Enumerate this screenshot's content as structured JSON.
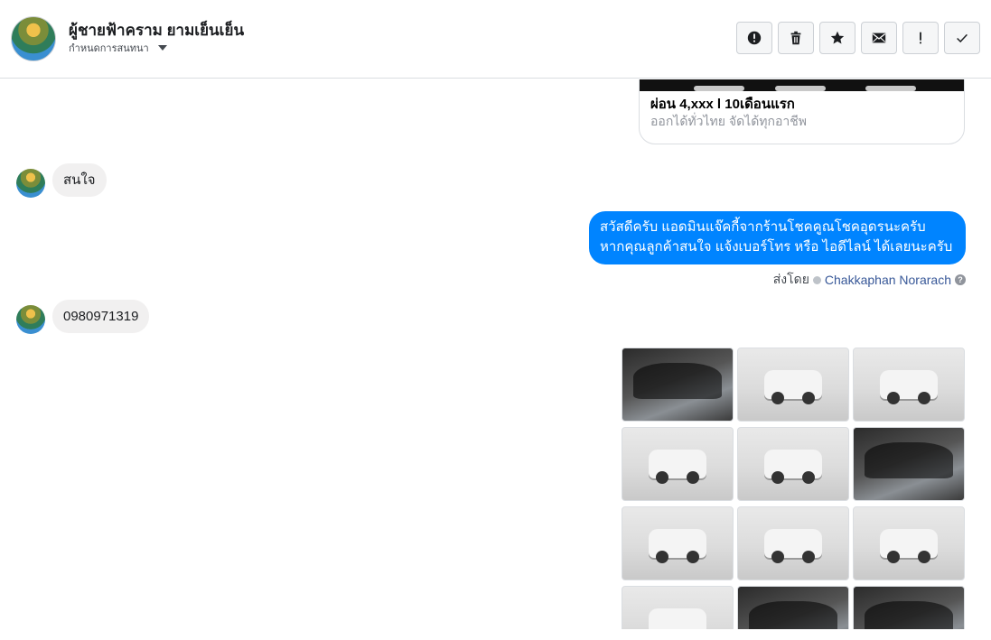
{
  "header": {
    "name": "ผู้ชายฟ้าคราม ยามเย็นเย็น",
    "subtitle": "กำหนดการสนทนา",
    "actions": [
      {
        "id": "report",
        "icon": "alert-circle-icon"
      },
      {
        "id": "delete",
        "icon": "trash-icon"
      },
      {
        "id": "star",
        "icon": "star-icon"
      },
      {
        "id": "mark-unread",
        "icon": "envelope-icon"
      },
      {
        "id": "important",
        "icon": "exclamation-icon"
      },
      {
        "id": "done",
        "icon": "checkmark-icon"
      }
    ]
  },
  "card": {
    "title": "ผ่อน 4,xxx l 10เดือนแรก",
    "subtitle": "ออกได้ทั่วไทย จัดได้ทุกอาชีพ"
  },
  "messages": {
    "incoming_1": "สนใจ",
    "outgoing_1_line1": "สวัสดีครับ แอดมินแจ๊คกี้จากร้านโชคคูณโชคอุดรนะครับ",
    "outgoing_1_line2": "หากคุณลูกค้าสนใจ แจ้งเบอร์โทร หรือ ไอดีไลน์ ได้เลยนะครับ",
    "sent_by_label": "ส่งโดย",
    "sent_by_name": "Chakkaphan Norarach",
    "incoming_2": "0980971319"
  },
  "gallery": {
    "photos": [
      {
        "kind": "interior"
      },
      {
        "kind": "exterior"
      },
      {
        "kind": "exterior"
      },
      {
        "kind": "exterior"
      },
      {
        "kind": "exterior"
      },
      {
        "kind": "interior"
      },
      {
        "kind": "exterior"
      },
      {
        "kind": "exterior"
      },
      {
        "kind": "exterior"
      },
      {
        "kind": "exterior"
      },
      {
        "kind": "interior"
      },
      {
        "kind": "interior"
      }
    ]
  },
  "colors": {
    "accent": "#0084ff",
    "incoming_bubble": "#f1f0f0",
    "link": "#385898"
  }
}
